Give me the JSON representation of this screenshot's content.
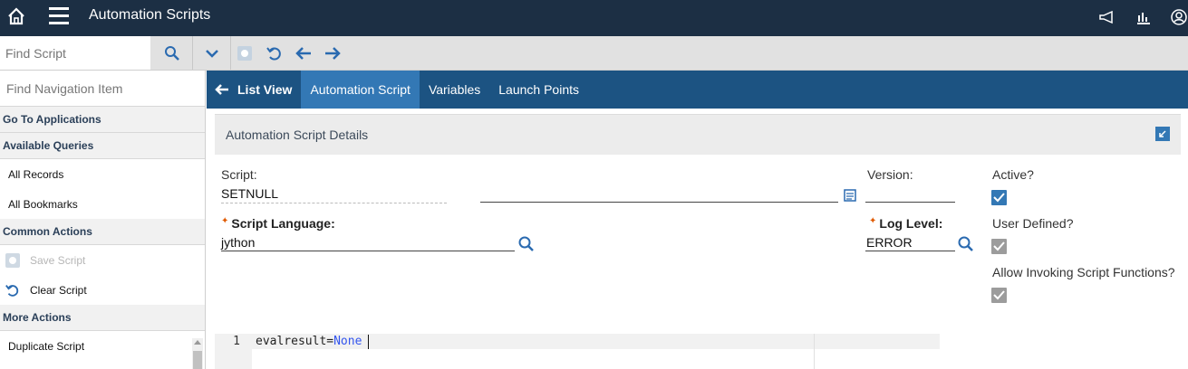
{
  "topbar": {
    "title": "Automation Scripts"
  },
  "toolbar": {
    "find_script_placeholder": "Find Script"
  },
  "leftnav": {
    "find_nav_placeholder": "Find Navigation Item",
    "go_to_applications": "Go To Applications",
    "available_queries": "Available Queries",
    "queries": [
      "All Records",
      "All Bookmarks"
    ],
    "common_actions": "Common Actions",
    "actions": [
      "Save Script",
      "Clear Script"
    ],
    "more_actions": "More Actions",
    "more": [
      "Duplicate Script"
    ]
  },
  "tabs": {
    "list_view": "List View",
    "automation_script": "Automation Script",
    "variables": "Variables",
    "launch_points": "Launch Points"
  },
  "details": {
    "section_title": "Automation Script Details",
    "script_label": "Script:",
    "script_value": "SETNULL",
    "version_label": "Version:",
    "script_language_label": "Script Language:",
    "script_language_value": "jython",
    "log_level_label": "Log Level:",
    "log_level_value": "ERROR",
    "active_label": "Active?",
    "active": true,
    "user_defined_label": "User Defined?",
    "user_defined": true,
    "allow_invoking_label": "Allow Invoking Script Functions?",
    "allow_invoking": true
  },
  "editor": {
    "line_number": "1",
    "code_var": "evalresult=",
    "code_kw": "None"
  },
  "colors": {
    "topbar": "#1c2f44",
    "tabbar": "#1c5382",
    "active_tab": "#3378b5",
    "required_star": "#e05a00"
  }
}
